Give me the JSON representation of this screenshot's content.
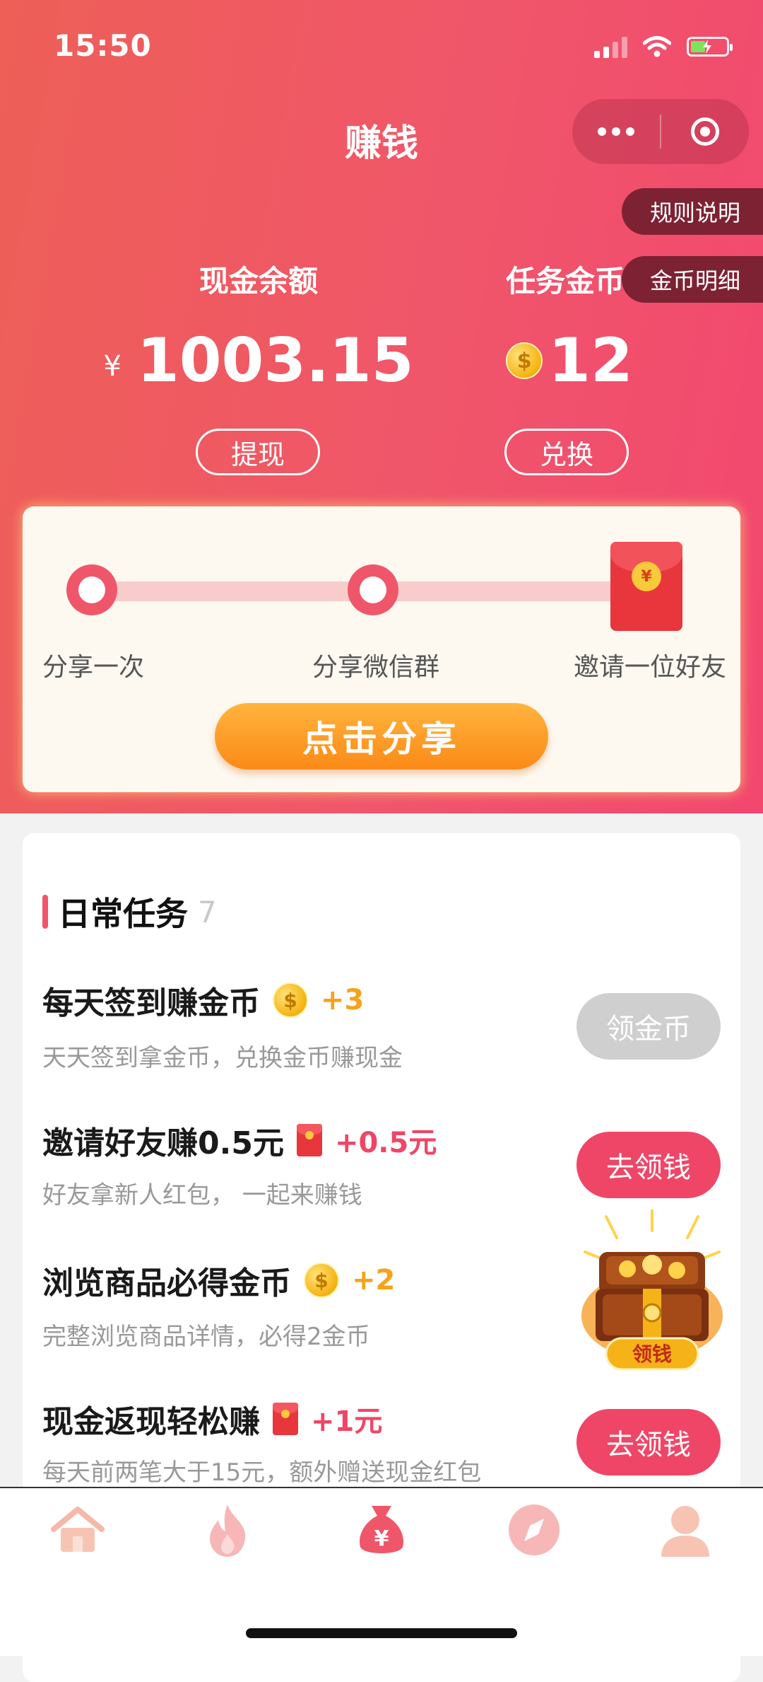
{
  "status_bar": {
    "time": "15:50"
  },
  "header": {
    "title": "赚钱",
    "rules_label": "规则说明",
    "coin_detail_label": "金币明细",
    "cash": {
      "label": "现金余额",
      "currency": "¥",
      "amount": "1003.15",
      "button": "提现"
    },
    "coins": {
      "label": "任务金币",
      "coin_symbol": "$",
      "amount": "12",
      "button": "兑换"
    }
  },
  "share_card": {
    "steps": [
      "分享一次",
      "分享微信群",
      "邀请一位好友"
    ],
    "packet_symbol": "¥",
    "button": "点击分享"
  },
  "daily_tasks": {
    "title": "日常任务",
    "count": "7",
    "items": [
      {
        "title": "每天签到赚金币",
        "reward_icon": "coin-icon",
        "reward": "+3",
        "desc": "天天签到拿金币，兑换金币赚现金",
        "button": "领金币",
        "state": "done"
      },
      {
        "title": "邀请好友赚0.5元",
        "reward_icon": "red-packet-icon",
        "reward": "+0.5元",
        "desc": "好友拿新人红包， 一起来赚钱",
        "button": "去领钱",
        "state": "active"
      },
      {
        "title": "浏览商品必得金币",
        "reward_icon": "coin-icon",
        "reward": "+2",
        "desc": "完整浏览商品详情，必得2金币",
        "button": "",
        "state": "none"
      },
      {
        "title": "现金返现轻松赚",
        "reward_icon": "red-packet-icon",
        "reward": "+1元",
        "desc": "每天前两笔大于15元，额外赠送现金红包",
        "button": "去领钱",
        "state": "active"
      }
    ],
    "chest_label": "领钱"
  },
  "bottom_nav": {
    "items": [
      {
        "icon": "home-icon"
      },
      {
        "icon": "flame-icon"
      },
      {
        "icon": "money-bag-icon",
        "active": true
      },
      {
        "icon": "compass-icon"
      },
      {
        "icon": "profile-icon"
      }
    ]
  },
  "colors": {
    "accent": "#f0566a",
    "gold": "#f5a31a",
    "button_orange": "#fb8a18"
  }
}
